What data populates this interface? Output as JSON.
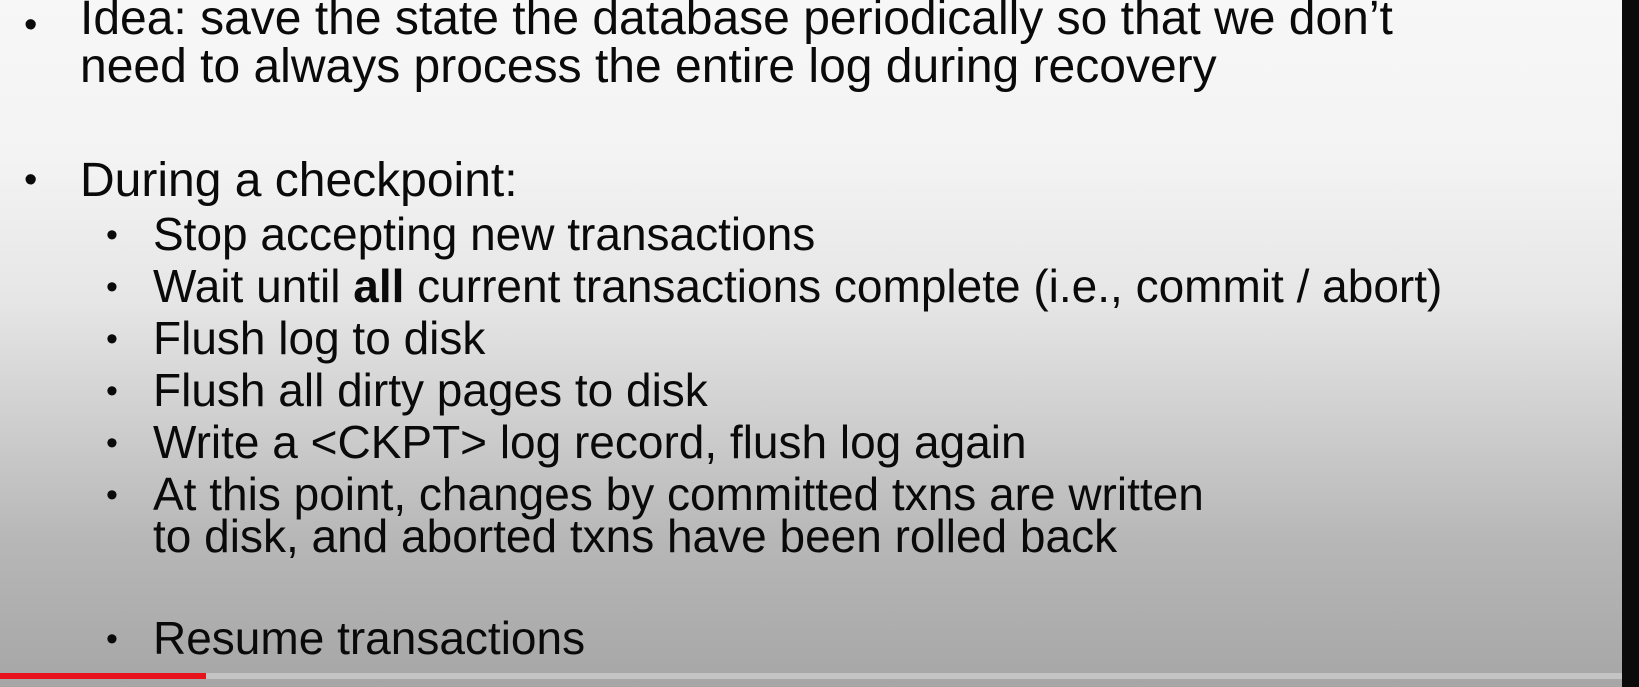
{
  "slide": {
    "items": [
      {
        "text_lines": [
          "Idea: save the state the database periodically so that we don’t",
          "need to always process the entire log during recovery"
        ]
      },
      {
        "text": "During a checkpoint:",
        "subitems": [
          {
            "text": "Stop accepting new transactions"
          },
          {
            "pre": "Wait until ",
            "bold": "all",
            "post": " current transactions complete (i.e., commit / abort)"
          },
          {
            "text": "Flush log to disk"
          },
          {
            "text": "Flush all dirty pages to disk"
          },
          {
            "text": "Write a <CKPT> log record, flush log again"
          },
          {
            "text_lines": [
              "At this point, changes by committed txns are written",
              "to disk, and aborted txns have been rolled back"
            ]
          },
          {
            "text": "Resume transactions"
          }
        ]
      }
    ]
  },
  "video": {
    "progress_fraction": 0.127,
    "played_color": "#e8121c"
  }
}
